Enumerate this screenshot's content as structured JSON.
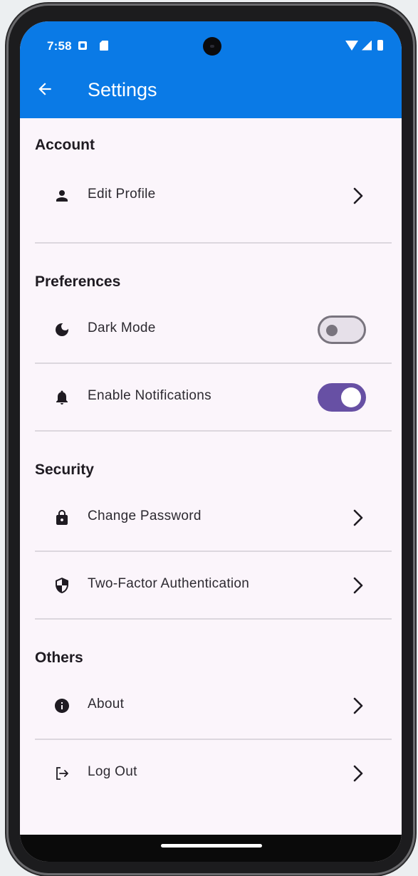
{
  "status_bar": {
    "time": "7:58"
  },
  "app_bar": {
    "title": "Settings",
    "back_icon": "arrow-back-icon"
  },
  "sections": [
    {
      "header": "Account",
      "items": [
        {
          "label": "Edit Profile",
          "icon": "person-icon",
          "control": "chevron"
        }
      ]
    },
    {
      "header": "Preferences",
      "items": [
        {
          "label": "Dark Mode",
          "icon": "moon-icon",
          "control": "switch",
          "switch_on": false
        },
        {
          "label": "Enable Notifications",
          "icon": "bell-icon",
          "control": "switch",
          "switch_on": true
        }
      ]
    },
    {
      "header": "Security",
      "items": [
        {
          "label": "Change Password",
          "icon": "lock-icon",
          "control": "chevron"
        },
        {
          "label": "Two-Factor Authentication",
          "icon": "shield-icon",
          "control": "chevron"
        }
      ]
    },
    {
      "header": "Others",
      "items": [
        {
          "label": "About",
          "icon": "info-icon",
          "control": "chevron"
        },
        {
          "label": "Log Out",
          "icon": "logout-icon",
          "control": "chevron"
        }
      ]
    }
  ],
  "colors": {
    "app_bar": "#0a7ae6",
    "background": "#fbf5fb",
    "switch_on": "#6750a4",
    "switch_off_outline": "#79747e"
  }
}
